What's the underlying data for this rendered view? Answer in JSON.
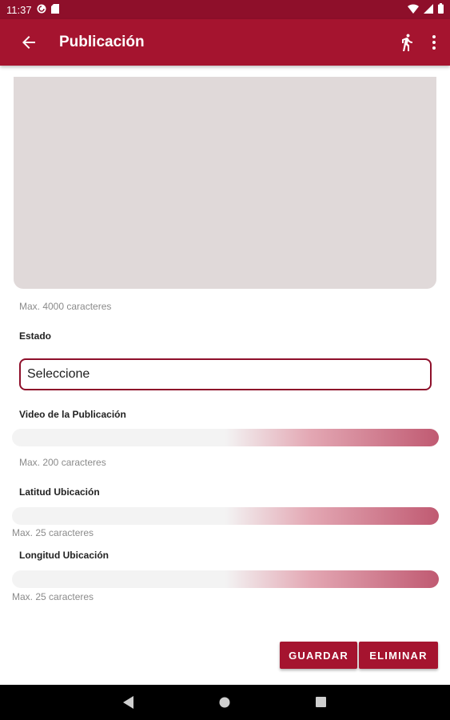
{
  "status_bar": {
    "time": "11:37"
  },
  "app_bar": {
    "title": "Publicación"
  },
  "form": {
    "description_helper": "Max. 4000 caracteres",
    "estado_label": "Estado",
    "estado_value": "Seleccione",
    "video_label": "Video de la Publicación",
    "video_helper": "Max. 200 caracteres",
    "latitud_label": "Latitud Ubicación",
    "latitud_helper": "Max. 25 caracteres",
    "longitud_label": "Longitud Ubicación",
    "longitud_helper": "Max. 25 caracteres"
  },
  "actions": {
    "save_label": "GUARDAR",
    "delete_label": "ELIMINAR"
  },
  "icons": {
    "status": [
      "pocket-casts-icon",
      "sd-card-icon",
      "wifi-icon",
      "signal-icon",
      "battery-icon"
    ],
    "app_bar": [
      "back-arrow-icon",
      "running-man-icon",
      "more-vert-icon"
    ],
    "nav": [
      "nav-back-icon",
      "nav-home-icon",
      "nav-recents-icon"
    ]
  },
  "colors": {
    "primary": "#a5142f",
    "primary_dark": "#8e0f2a",
    "textarea_bg": "#e0d9d9"
  }
}
